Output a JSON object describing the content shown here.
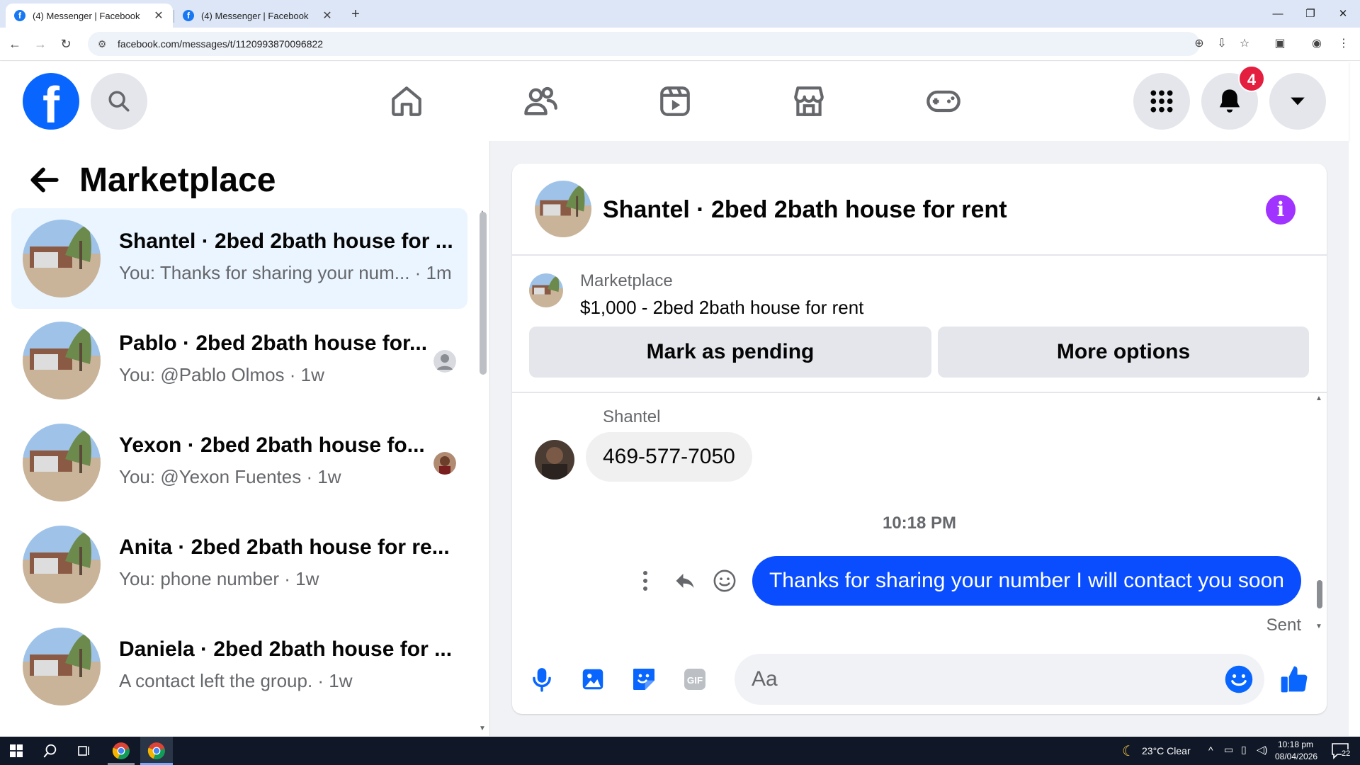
{
  "browser": {
    "tabs": [
      {
        "title": "(4) Messenger | Facebook",
        "active": true
      },
      {
        "title": "(4) Messenger | Facebook",
        "active": false
      }
    ],
    "url": "facebook.com/messages/t/1120993870096822"
  },
  "header": {
    "logo_letter": "f",
    "notification_count": "4",
    "nav_icons": [
      "home-icon",
      "friends-icon",
      "video-icon",
      "marketplace-icon",
      "gaming-icon"
    ]
  },
  "sidebar": {
    "title": "Marketplace",
    "conversations": [
      {
        "title": "Shantel · 2bed 2bath house for ...",
        "subtitle": "You: Thanks for sharing your num... · 1m",
        "selected": true
      },
      {
        "title": "Pablo · 2bed 2bath house for...",
        "subtitle": "You: @Pablo Olmos · 1w",
        "selected": false
      },
      {
        "title": "Yexon · 2bed 2bath house fo...",
        "subtitle": "You: @Yexon Fuentes · 1w",
        "selected": false
      },
      {
        "title": "Anita · 2bed 2bath house for re...",
        "subtitle": "You: phone number · 1w",
        "selected": false
      },
      {
        "title": "Daniela · 2bed 2bath house for ...",
        "subtitle": "A contact left the group. · 1w",
        "selected": false
      }
    ]
  },
  "chat": {
    "title": "Shantel · 2bed 2bath house for rent",
    "listing": {
      "label": "Marketplace",
      "price_title": "$1,000 - 2bed 2bath house for rent",
      "mark_pending": "Mark as pending",
      "more_options": "More options"
    },
    "messages": {
      "sender_name": "Shantel",
      "received_text": "469-577-7050",
      "timestamp": "10:18 PM",
      "sent_text": "Thanks for sharing your number I will contact you soon",
      "status": "Sent"
    },
    "composer": {
      "placeholder": "Aa"
    }
  },
  "taskbar": {
    "weather": "23°C  Clear",
    "time": "10:18 pm",
    "date": "08/04/2026",
    "notification_count": "22"
  },
  "colors": {
    "accent": "#0866ff",
    "sent_bubble": "#0a4dff",
    "selected_conv": "#ebf5ff",
    "info_icon": "#a033ff",
    "badge": "#e41e3f"
  }
}
